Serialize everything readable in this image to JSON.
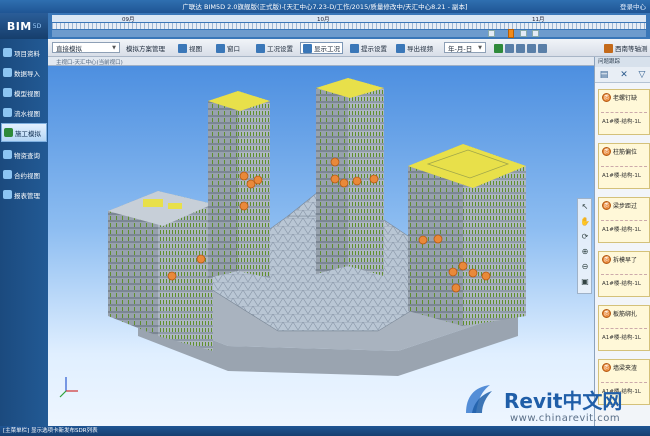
{
  "window": {
    "title": "广联达 BIM5D 2.0旗舰版(正式版)-[天汇中心7.23-D/工作/2015/质量修改中/天汇中心8.21 - 副本]",
    "login_label": "登录中心"
  },
  "logo": {
    "text": "BIM",
    "suffix": "5D"
  },
  "timeline": {
    "months": [
      "09月",
      "10月",
      "11月"
    ],
    "controls": [
      "play",
      "pause",
      "stop"
    ]
  },
  "toolbar": {
    "mode_select": "直接模拟",
    "plan_label": "模拟方案管理",
    "view_label": "视图",
    "window_label": "窗口",
    "settings_label": "工况设置",
    "display_label": "显示工况",
    "hint_label": "提示设置",
    "export_label": "导出视频",
    "date_select": "年-月-日",
    "weather_label": "西南等轴测"
  },
  "sidebar": {
    "items": [
      {
        "label": "项目资料",
        "active": false
      },
      {
        "label": "数据导入",
        "active": false
      },
      {
        "label": "模型视图",
        "active": false
      },
      {
        "label": "流水视图",
        "active": false
      },
      {
        "label": "施工模拟",
        "active": true
      },
      {
        "label": "物资查询",
        "active": false
      },
      {
        "label": "合约视图",
        "active": false
      },
      {
        "label": "报表管理",
        "active": false
      }
    ]
  },
  "viewport": {
    "tab_label": "主视口-天汇中心(当前视口)"
  },
  "right_panel": {
    "header": "问题跟踪",
    "cards": [
      {
        "badge": "质",
        "title": "老螺钉缺",
        "sub": "A1#楼-结构-1L"
      },
      {
        "badge": "质",
        "title": "柱筋偏位",
        "sub": "A1#楼-结构-1L"
      },
      {
        "badge": "质",
        "title": "梁步距过",
        "sub": "A1#楼-结构-1L"
      },
      {
        "badge": "质",
        "title": "拆模早了",
        "sub": "A1#楼-结构-1L"
      },
      {
        "badge": "质",
        "title": "板筋绑扎",
        "sub": "A1#楼-结构-1L"
      },
      {
        "badge": "质",
        "title": "墙梁夹渣",
        "sub": "A1#楼-结构-1L"
      }
    ]
  },
  "statusbar": {
    "text": "[主菜单栏] 显示选项卡新发布SDR列表"
  },
  "watermark": {
    "brand": "Revit中文网",
    "url": "www.chinarevit.com"
  },
  "colors": {
    "accent": "#1f5594",
    "active_nav": "#b5d6f5",
    "marker": "#f28a1a",
    "pin": "#e9893a"
  }
}
